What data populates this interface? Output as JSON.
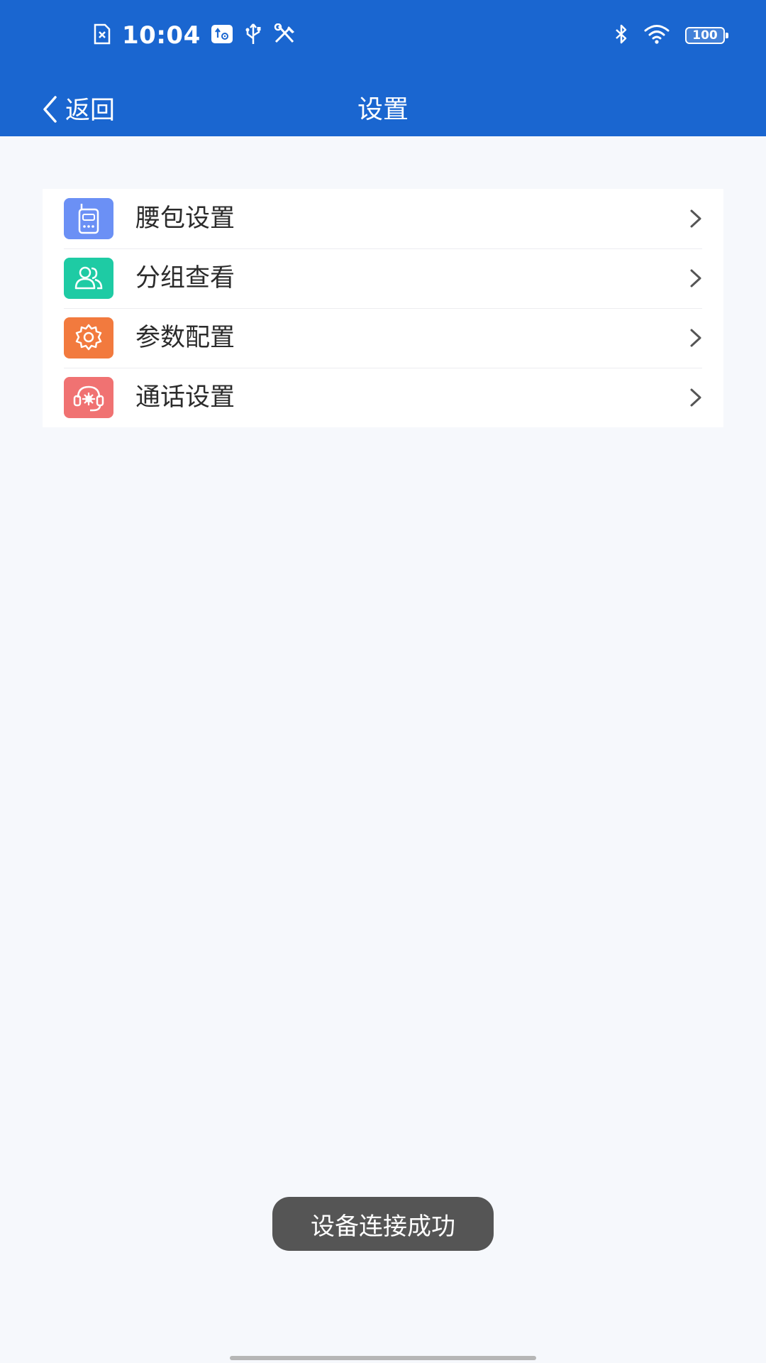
{
  "status_bar": {
    "time": "10:04",
    "battery": "100",
    "icons": [
      "sim-card-x-icon",
      "usb-debug-icon",
      "usb-icon",
      "tools-icon",
      "bluetooth-icon",
      "wifi-icon",
      "battery-icon"
    ]
  },
  "nav": {
    "back_label": "返回",
    "title": "设置"
  },
  "menu": {
    "items": [
      {
        "label": "腰包设置",
        "icon": "walkie-talkie-icon",
        "color": "#6b90f5"
      },
      {
        "label": "分组查看",
        "icon": "group-users-icon",
        "color": "#1ecba4"
      },
      {
        "label": "参数配置",
        "icon": "gear-icon",
        "color": "#f27a3e"
      },
      {
        "label": "通话设置",
        "icon": "headset-icon",
        "color": "#f07272"
      }
    ]
  },
  "toast": {
    "message": "设备连接成功"
  },
  "colors": {
    "header": "#1a66d0",
    "background": "#f6f8fc",
    "toast": "#555555"
  }
}
